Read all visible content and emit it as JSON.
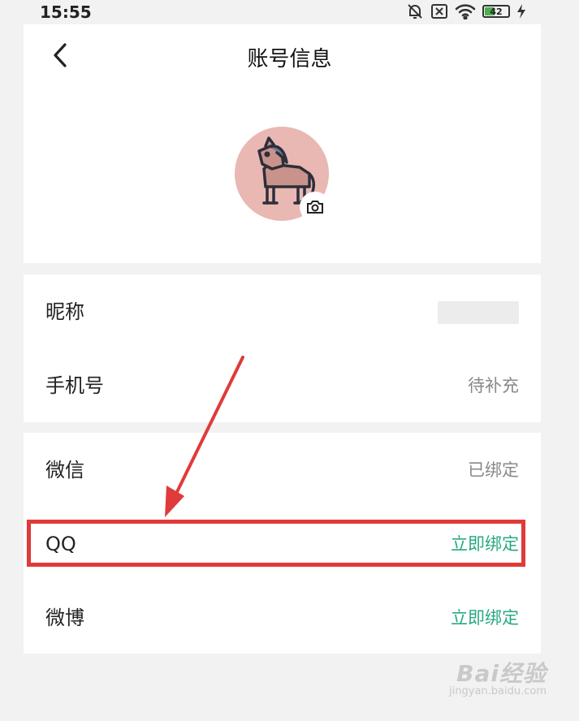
{
  "status_bar": {
    "time": "15:55",
    "battery_level": "42"
  },
  "header": {
    "title": "账号信息"
  },
  "rows": [
    {
      "label": "昵称",
      "value": ""
    },
    {
      "label": "手机号",
      "value": "待补充"
    },
    {
      "label": "微信",
      "value": "已绑定"
    },
    {
      "label": "QQ",
      "value": "立即绑定"
    },
    {
      "label": "微博",
      "value": "立即绑定"
    }
  ],
  "colors": {
    "accent_green": "#27a983",
    "annotation_red": "#e03a3a",
    "avatar_bg": "#e9b8b3"
  },
  "watermark": {
    "brand": "Bai经验",
    "url": "jingyan.baidu.com"
  }
}
